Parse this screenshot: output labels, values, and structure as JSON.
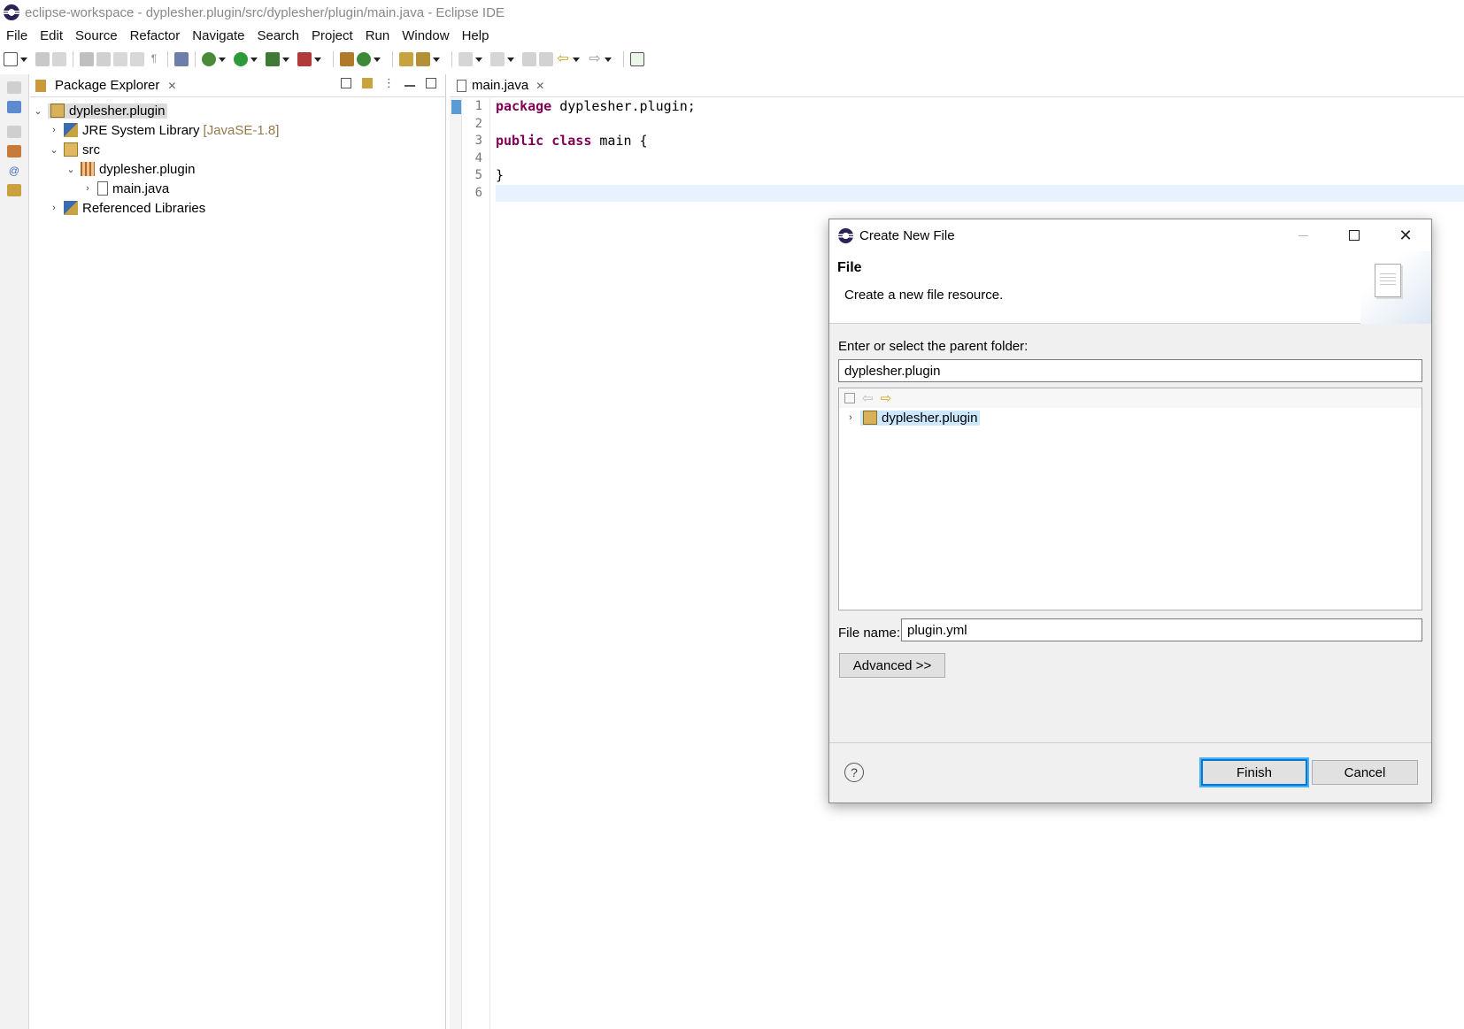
{
  "window": {
    "title": "eclipse-workspace - dyplesher.plugin/src/dyplesher/plugin/main.java - Eclipse IDE"
  },
  "menu": [
    "File",
    "Edit",
    "Source",
    "Refactor",
    "Navigate",
    "Search",
    "Project",
    "Run",
    "Window",
    "Help"
  ],
  "package_explorer": {
    "tab_label": "Package Explorer",
    "tree": [
      {
        "label": "dyplesher.plugin",
        "icon": "project-icon",
        "expanded": true
      },
      {
        "label": "JRE System Library",
        "tag": "[JavaSE-1.8]",
        "icon": "library-icon"
      },
      {
        "label": "src",
        "icon": "source-folder-icon",
        "expanded": true
      },
      {
        "label": "dyplesher.plugin",
        "icon": "package-icon",
        "expanded": true
      },
      {
        "label": "main.java",
        "icon": "java-file-icon"
      },
      {
        "label": "Referenced Libraries",
        "icon": "library-icon"
      }
    ]
  },
  "editor": {
    "tab_label": "main.java",
    "line_numbers": [
      "1",
      "2",
      "3",
      "4",
      "5",
      "6"
    ],
    "lines": [
      {
        "keyword": "package",
        "text": " dyplesher.plugin;"
      },
      {
        "keyword": "",
        "text": ""
      },
      {
        "keyword": "public class",
        "text": " main {"
      },
      {
        "keyword": "",
        "text": ""
      },
      {
        "keyword": "",
        "text": "}"
      },
      {
        "keyword": "",
        "text": ""
      }
    ]
  },
  "dialog": {
    "title": "Create New File",
    "header_title": "File",
    "header_desc": "Create a new file resource.",
    "parent_label": "Enter or select the parent folder:",
    "parent_value": "dyplesher.plugin",
    "folder_tree_item": "dyplesher.plugin",
    "file_name_label": "File name:",
    "file_name_value": "plugin.yml",
    "advanced_label": "Advanced >>",
    "finish_label": "Finish",
    "cancel_label": "Cancel",
    "help_glyph": "?"
  },
  "colors": {
    "keyword": "#7f0055",
    "selection": "#cce8ff",
    "focus": "#0078d7",
    "jre_tag": "#95794b"
  }
}
